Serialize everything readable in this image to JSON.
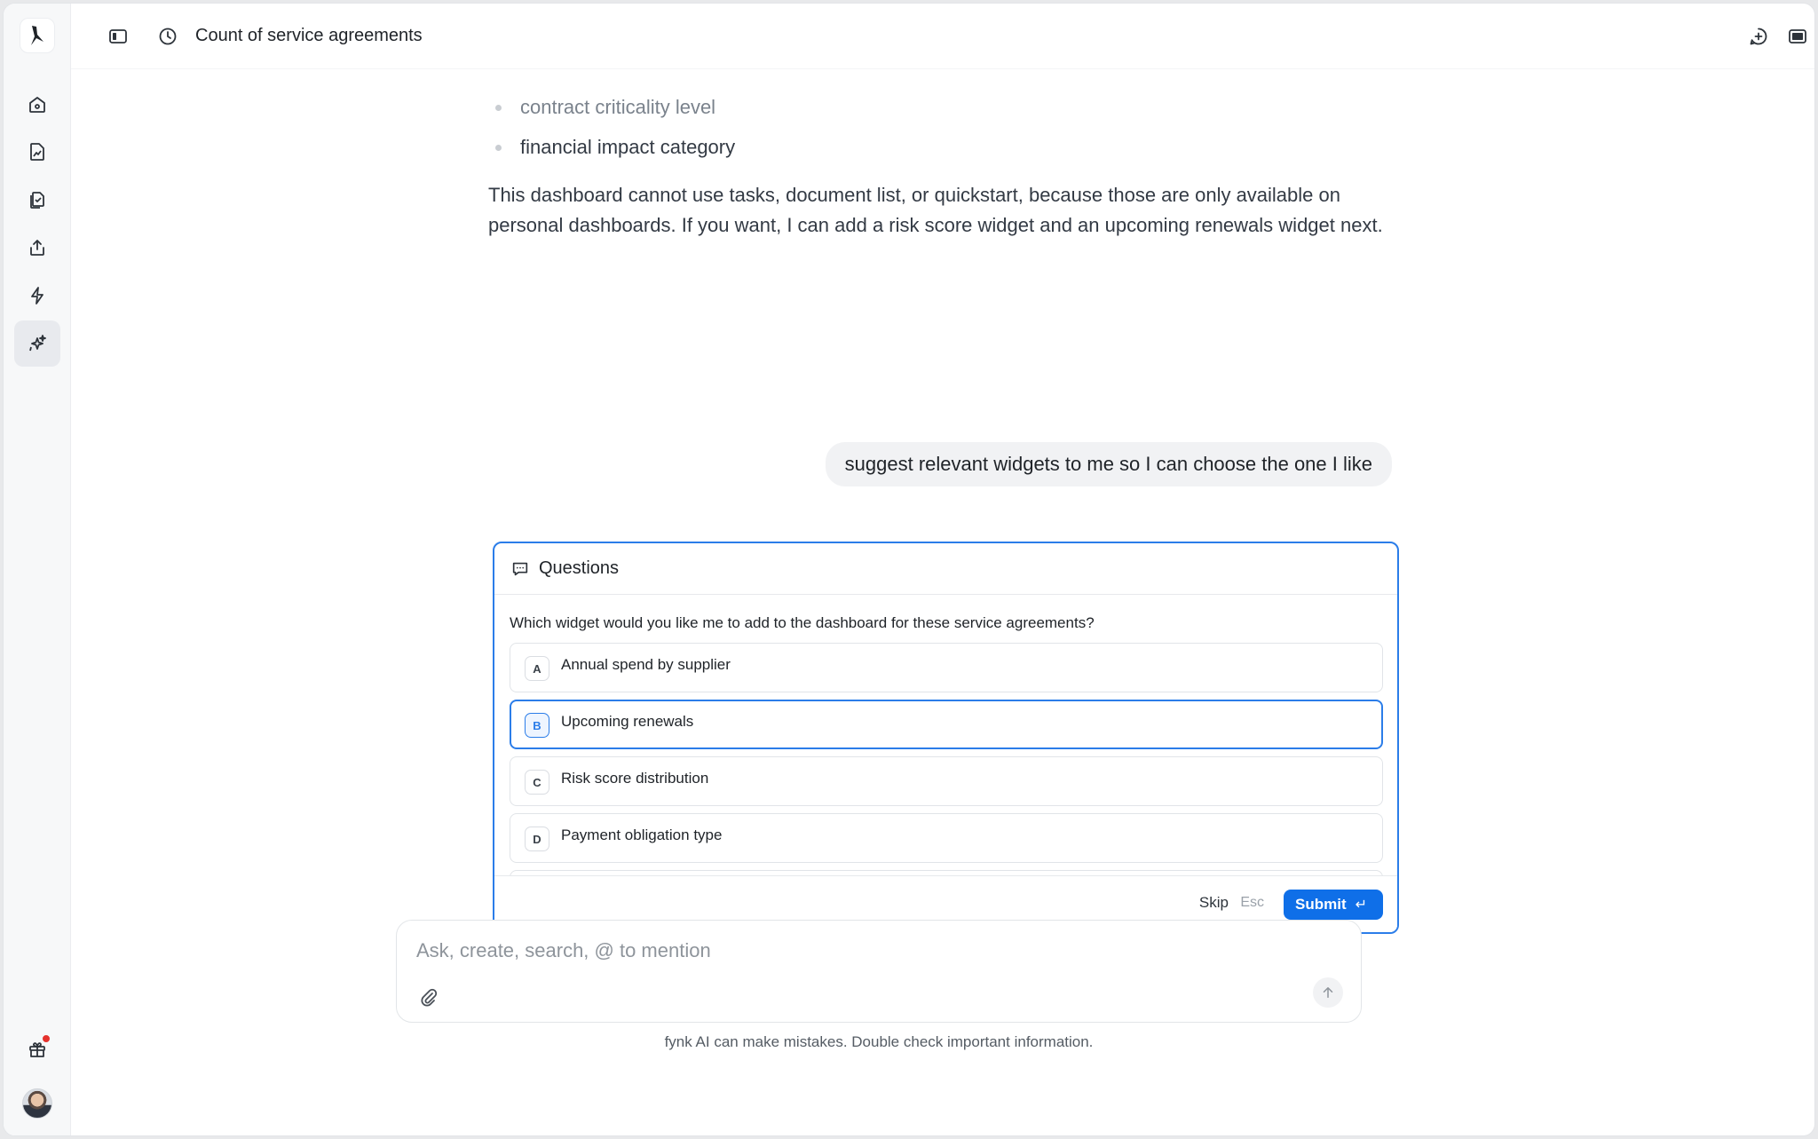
{
  "header": {
    "title": "Count of service agreements"
  },
  "conversation": {
    "bullets": [
      "contract criticality level",
      "financial impact category"
    ],
    "paragraph": "This dashboard cannot use tasks, document list, or quickstart, because those are only available on personal dashboards. If you want, I can add a risk score widget and an upcoming renewals widget next.",
    "user_message": "suggest relevant widgets to me so I can choose the one I like"
  },
  "questions": {
    "title": "Questions",
    "question": "Which widget would you like me to add to the dashboard for these service agreements?",
    "options": [
      {
        "key": "A",
        "label": "Annual spend by supplier"
      },
      {
        "key": "B",
        "label": "Upcoming renewals"
      },
      {
        "key": "C",
        "label": "Risk score distribution"
      },
      {
        "key": "D",
        "label": "Payment obligation type"
      }
    ],
    "selected": "B",
    "skip_label": "Skip",
    "skip_key": "Esc",
    "submit_label": "Submit",
    "submit_key": "↵"
  },
  "composer": {
    "placeholder": "Ask, create, search, @ to mention",
    "disclaimer": "fynk AI can make mistakes. Double check important information."
  },
  "sidebar": {
    "items": [
      "home-icon",
      "document-chart-icon",
      "documents-icon",
      "upload-icon",
      "lightning-icon",
      "sparkles-icon"
    ],
    "active": "sparkles-icon"
  },
  "colors": {
    "accent": "#2b7de9",
    "submit": "#0f6fe8",
    "notification": "#e5322d"
  }
}
